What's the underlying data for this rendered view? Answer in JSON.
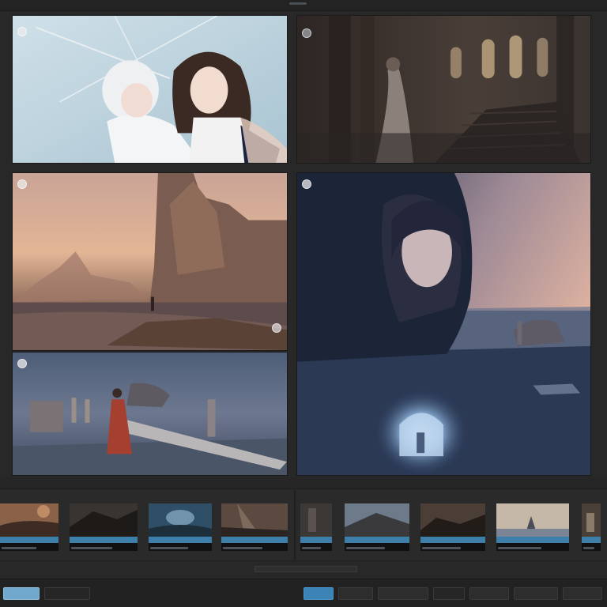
{
  "app": {
    "title": ""
  },
  "panels": [
    {
      "id": "p1",
      "caption": ""
    },
    {
      "id": "p2",
      "caption": ""
    },
    {
      "id": "p3",
      "caption": ""
    },
    {
      "id": "p4",
      "caption": ""
    },
    {
      "id": "p5",
      "caption": ""
    }
  ],
  "labels": {
    "left": "",
    "center": "",
    "right": "",
    "filmstrip_header": ""
  },
  "thumbnails": [
    {
      "caption": ""
    },
    {
      "caption": ""
    },
    {
      "caption": ""
    },
    {
      "caption": ""
    },
    {
      "caption": ""
    },
    {
      "caption": ""
    },
    {
      "caption": ""
    },
    {
      "caption": ""
    },
    {
      "caption": ""
    }
  ],
  "status": {
    "text": ""
  },
  "bottombar": {
    "left_button": "",
    "primary_button": "",
    "buttons": [
      "",
      "",
      "",
      "",
      "",
      ""
    ]
  },
  "colors": {
    "accent": "#3c83b6",
    "accent_light": "#6fa8cc",
    "bg": "#282828"
  },
  "icons": [
    "avatar-icon",
    "sun-icon"
  ]
}
